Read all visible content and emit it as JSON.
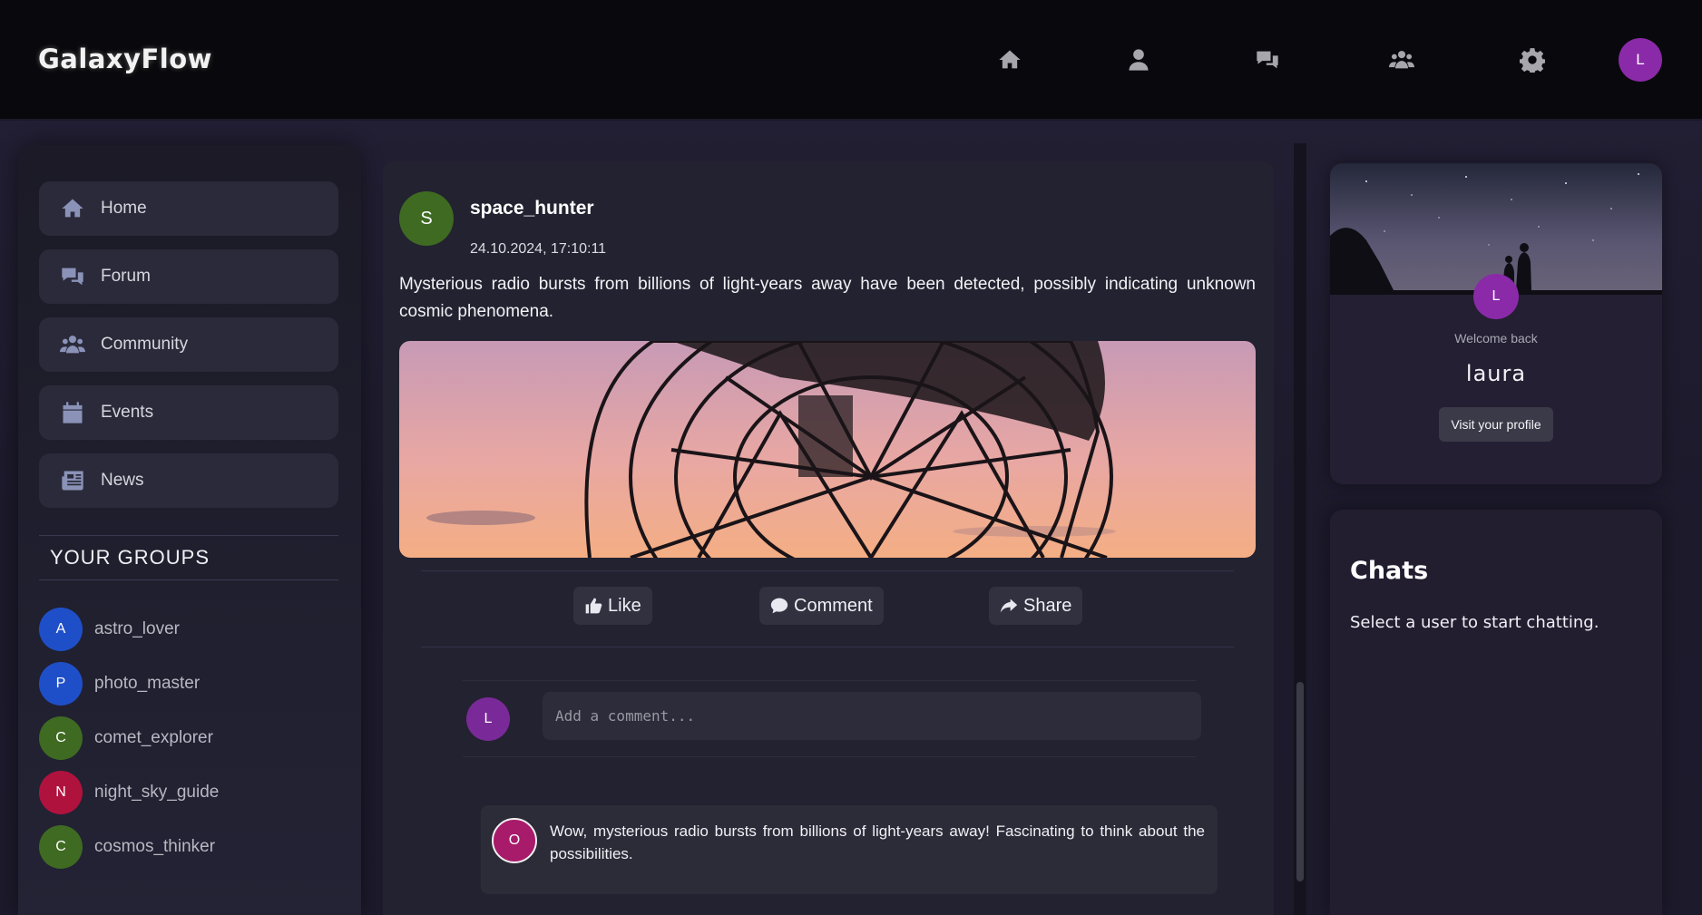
{
  "app": {
    "logo": "GalaxyFlow",
    "user_initial": "L"
  },
  "topnav": {
    "icons": [
      "home-icon",
      "user-icon",
      "chat-icon",
      "users-icon",
      "gear-icon"
    ]
  },
  "sidebar": {
    "items": [
      {
        "label": "Home",
        "icon": "home-icon"
      },
      {
        "label": "Forum",
        "icon": "chat-icon"
      },
      {
        "label": "Community",
        "icon": "users-icon"
      },
      {
        "label": "Events",
        "icon": "calendar-icon"
      },
      {
        "label": "News",
        "icon": "newspaper-icon"
      }
    ],
    "groups_title": "YOUR GROUPS",
    "groups": [
      {
        "initial": "A",
        "name": "astro_lover",
        "color": "#1f4fc8"
      },
      {
        "initial": "P",
        "name": "photo_master",
        "color": "#1f4fc8"
      },
      {
        "initial": "C",
        "name": "comet_explorer",
        "color": "#3f6a22"
      },
      {
        "initial": "N",
        "name": "night_sky_guide",
        "color": "#b0123e"
      },
      {
        "initial": "C",
        "name": "cosmos_thinker",
        "color": "#3f6a22"
      }
    ]
  },
  "post": {
    "initial": "S",
    "username": "space_hunter",
    "timestamp": "24.10.2024, 17:10:11",
    "text": "Mysterious radio bursts from billions of light-years away have been detected, possibly indicating unknown cosmic phenomena.",
    "actions": {
      "like": "Like",
      "comment": "Comment",
      "share": "Share"
    },
    "comment_placeholder": "Add a comment...",
    "my_initial": "L",
    "replies": [
      {
        "initial": "O",
        "text": "Wow, mysterious radio bursts from billions of light-years away! Fascinating to think about the possibilities."
      }
    ]
  },
  "profile": {
    "initial": "L",
    "welcome": "Welcome back",
    "name": "laura",
    "visit_label": "Visit your profile"
  },
  "chats": {
    "title": "Chats",
    "subtitle": "Select a user to start chatting."
  },
  "colors": {
    "accent_purple": "#8a2aa8",
    "background": "#1a1728"
  }
}
